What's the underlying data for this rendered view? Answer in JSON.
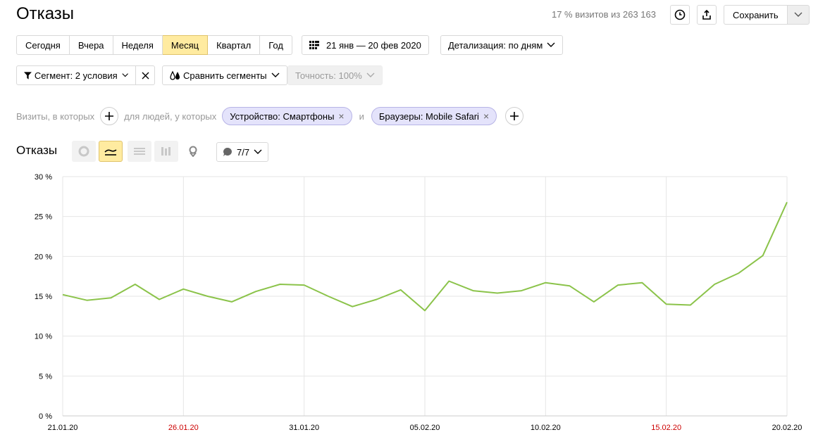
{
  "header": {
    "title": "Отказы",
    "visits_summary": "17 % визитов из 263 163",
    "save_label": "Сохранить"
  },
  "periods": [
    {
      "label": "Сегодня",
      "active": false
    },
    {
      "label": "Вчера",
      "active": false
    },
    {
      "label": "Неделя",
      "active": false
    },
    {
      "label": "Месяц",
      "active": true
    },
    {
      "label": "Квартал",
      "active": false
    },
    {
      "label": "Год",
      "active": false
    }
  ],
  "date_range": "21 янв — 20 фев 2020",
  "detail": "Детализация: по дням",
  "segment": "Сегмент: 2 условия",
  "compare": "Сравнить сегменты",
  "accuracy": "Точность: 100%",
  "conditions": {
    "visits_label": "Визиты, в которых",
    "people_label": "для людей, у которых",
    "and_label": "и",
    "tags": [
      "Устройство: Смартфоны",
      "Браузеры: Mobile Safari"
    ]
  },
  "metric": {
    "title": "Отказы",
    "notes_count": "7/7"
  },
  "colors": {
    "line": "#8bc34a",
    "holiday": "#cc0000",
    "grid": "#e6e6e6",
    "accent": "#ffeba0"
  },
  "chart_data": {
    "type": "line",
    "x": [
      "21.01.20",
      "22.01.20",
      "23.01.20",
      "24.01.20",
      "25.01.20",
      "26.01.20",
      "27.01.20",
      "28.01.20",
      "29.01.20",
      "30.01.20",
      "31.01.20",
      "01.02.20",
      "02.02.20",
      "03.02.20",
      "04.02.20",
      "05.02.20",
      "06.02.20",
      "07.02.20",
      "08.02.20",
      "09.02.20",
      "10.02.20",
      "11.02.20",
      "12.02.20",
      "13.02.20",
      "14.02.20",
      "15.02.20",
      "16.02.20",
      "17.02.20",
      "18.02.20",
      "19.02.20",
      "20.02.20"
    ],
    "series": [
      {
        "values": [
          15.2,
          14.5,
          14.8,
          16.5,
          14.6,
          15.9,
          15.0,
          14.3,
          15.6,
          16.5,
          16.4,
          15.0,
          13.7,
          14.6,
          15.8,
          13.2,
          16.9,
          15.7,
          15.4,
          15.7,
          16.7,
          16.3,
          14.3,
          16.4,
          16.7,
          14.0,
          13.9,
          16.5,
          17.9,
          20.1,
          26.8
        ]
      }
    ],
    "x_tick_labels": [
      {
        "label": "21.01.20",
        "index": 0,
        "holiday": false
      },
      {
        "label": "26.01.20",
        "index": 5,
        "holiday": true
      },
      {
        "label": "31.01.20",
        "index": 10,
        "holiday": false
      },
      {
        "label": "05.02.20",
        "index": 15,
        "holiday": false
      },
      {
        "label": "10.02.20",
        "index": 20,
        "holiday": false
      },
      {
        "label": "15.02.20",
        "index": 25,
        "holiday": true
      },
      {
        "label": "20.02.20",
        "index": 30,
        "holiday": false
      }
    ],
    "y_ticks": [
      0,
      5,
      10,
      15,
      20,
      25,
      30
    ],
    "y_tick_labels": [
      "0 %",
      "5 %",
      "10 %",
      "15 %",
      "20 %",
      "25 %",
      "30 %"
    ],
    "ylim": [
      0,
      30
    ],
    "grid": true
  }
}
